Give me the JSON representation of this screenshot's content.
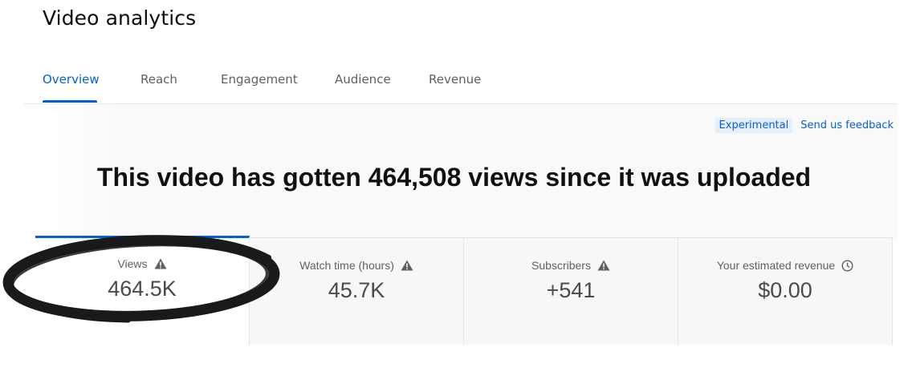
{
  "header": {
    "title": "Video analytics"
  },
  "tabs": [
    {
      "label": "Overview",
      "active": true
    },
    {
      "label": "Reach",
      "active": false
    },
    {
      "label": "Engagement",
      "active": false
    },
    {
      "label": "Audience",
      "active": false
    },
    {
      "label": "Revenue",
      "active": false
    }
  ],
  "feedback": {
    "experimental_label": "Experimental",
    "feedback_link": "Send us feedback"
  },
  "headline": "This video has gotten 464,508 views since it was uploaded",
  "metrics": [
    {
      "label": "Views",
      "value": "464.5K",
      "icon": "warning-icon",
      "selected": true
    },
    {
      "label": "Watch time (hours)",
      "value": "45.7K",
      "icon": "warning-icon",
      "selected": false
    },
    {
      "label": "Subscribers",
      "value": "+541",
      "icon": "warning-icon",
      "selected": false
    },
    {
      "label": "Your estimated revenue",
      "value": "$0.00",
      "icon": "clock-icon",
      "selected": false
    }
  ],
  "colors": {
    "accent": "#065fd4",
    "annotation_ink": "#1a1a1a"
  }
}
